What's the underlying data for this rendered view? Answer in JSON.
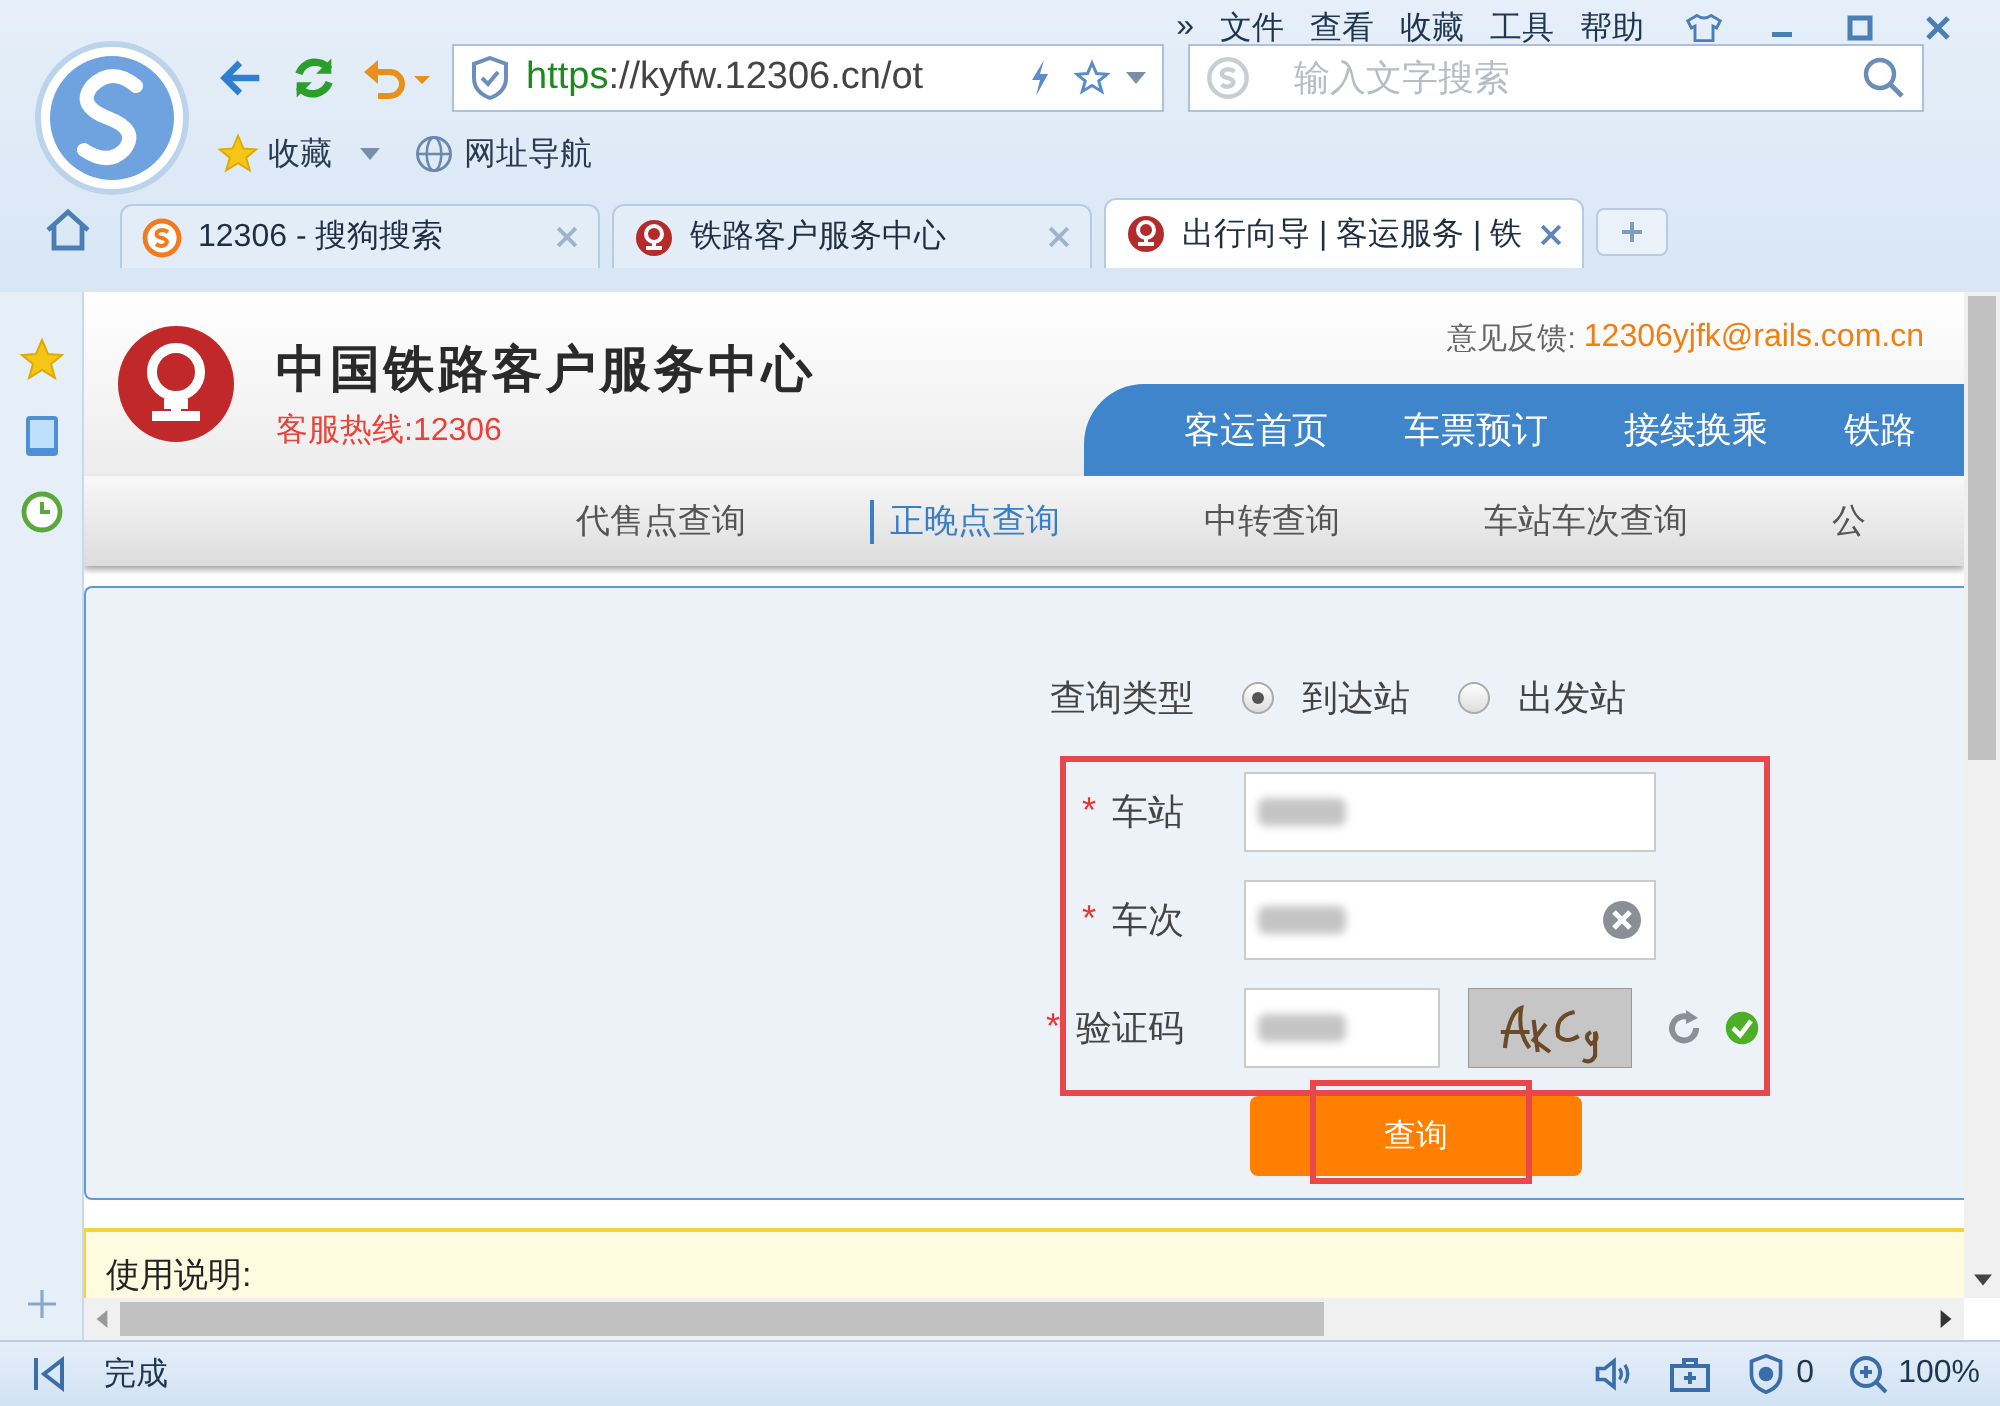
{
  "window": {
    "menu": [
      "»",
      "文件",
      "查看",
      "收藏",
      "工具",
      "帮助"
    ]
  },
  "toolbar": {
    "address": {
      "scheme": "https",
      "rest": "://kyfw.12306.cn/ot"
    },
    "search": {
      "placeholder": "输入文字搜索"
    }
  },
  "bookmarks": [
    "收藏",
    "网址导航"
  ],
  "tabs": [
    {
      "title": "12306 - 搜狗搜索",
      "selected": false,
      "kind": "sogou"
    },
    {
      "title": "铁路客户服务中心",
      "selected": false,
      "kind": "rail"
    },
    {
      "title": "出行向导 | 客运服务 | 铁",
      "selected": true,
      "kind": "rail"
    }
  ],
  "page": {
    "feedback_label": "意见反馈:",
    "feedback_email": "12306yjfk@rails.com.cn",
    "site_title": "中国铁路客户服务中心",
    "hotline": "客服热线:12306",
    "nav": [
      "客运首页",
      "车票预订",
      "接续换乘",
      "铁路"
    ],
    "subnav": [
      {
        "label": "代售点查询",
        "selected": false
      },
      {
        "label": "正晚点查询",
        "selected": true
      },
      {
        "label": "中转查询",
        "selected": false
      },
      {
        "label": "车站车次查询",
        "selected": false
      },
      {
        "label": "公",
        "selected": false
      }
    ],
    "form": {
      "query_type_label": "查询类型",
      "options": [
        {
          "label": "到达站",
          "selected": true
        },
        {
          "label": "出发站",
          "selected": false
        }
      ],
      "fields": [
        {
          "label": "车站",
          "required_mark": "*",
          "kind": "text"
        },
        {
          "label": "车次",
          "required_mark": "*",
          "kind": "clearable"
        },
        {
          "label": "验证码",
          "required_mark": "*",
          "kind": "captcha"
        }
      ],
      "button": "查询"
    },
    "notice": "使用说明:"
  },
  "status_bar": {
    "text": "完成",
    "blocked": "0",
    "zoom": "100%"
  }
}
